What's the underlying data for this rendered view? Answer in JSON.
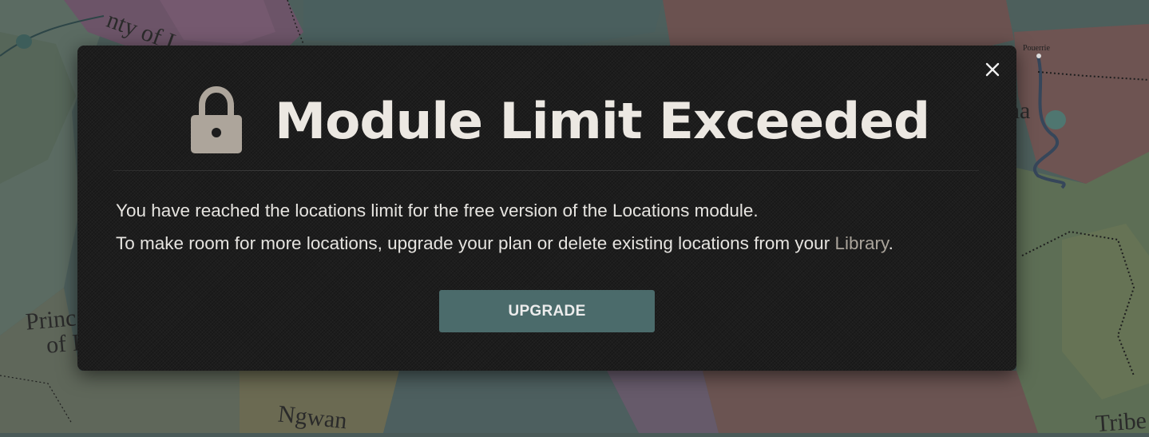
{
  "map": {
    "labels": {
      "county": "nty of L",
      "pouerrie": "Pouerrie",
      "na": "na",
      "princ": "Princ",
      "of": "of I",
      "ngwan": "Ngwan",
      "tribe": "Tribe"
    }
  },
  "modal": {
    "title": "Module Limit Exceeded",
    "lock_icon": "lock-icon",
    "close_icon": "close-icon",
    "message_line1": "You have reached the locations limit for the free version of the Locations module.",
    "message_line2_prefix": "To make room for more locations, upgrade your plan or delete existing locations from your ",
    "library_link": "Library",
    "message_line2_suffix": ".",
    "upgrade_button": "UPGRADE"
  },
  "colors": {
    "modal_bg": "#1d1d1d",
    "title": "#ece8e2",
    "lock": "#ada59b",
    "button_bg": "#4b6b6b",
    "link": "#aaa49b"
  }
}
